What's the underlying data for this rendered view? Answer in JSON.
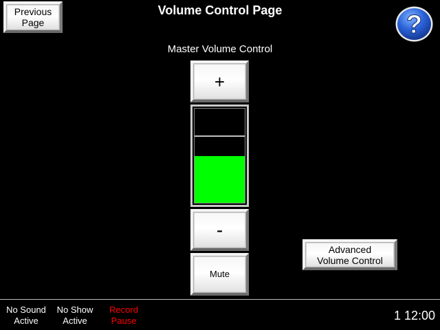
{
  "header": {
    "title": "Volume Control Page",
    "previous_page_label": "Previous\nPage",
    "help_icon": "question-mark-icon"
  },
  "volume": {
    "section_label": "Master Volume Control",
    "plus_label": "+",
    "minus_label": "-",
    "mute_label": "Mute",
    "level_fraction": 0.5,
    "marker_fraction": 0.7,
    "fill_color": "#00ff00"
  },
  "advanced": {
    "label": "Advanced\nVolume Control"
  },
  "status_bar": {
    "sound_status": "No Sound\nActive",
    "show_status": "No Show\nActive",
    "record_status": "Record\nPause",
    "record_color": "#ff0000",
    "clock": "1  12:00"
  }
}
